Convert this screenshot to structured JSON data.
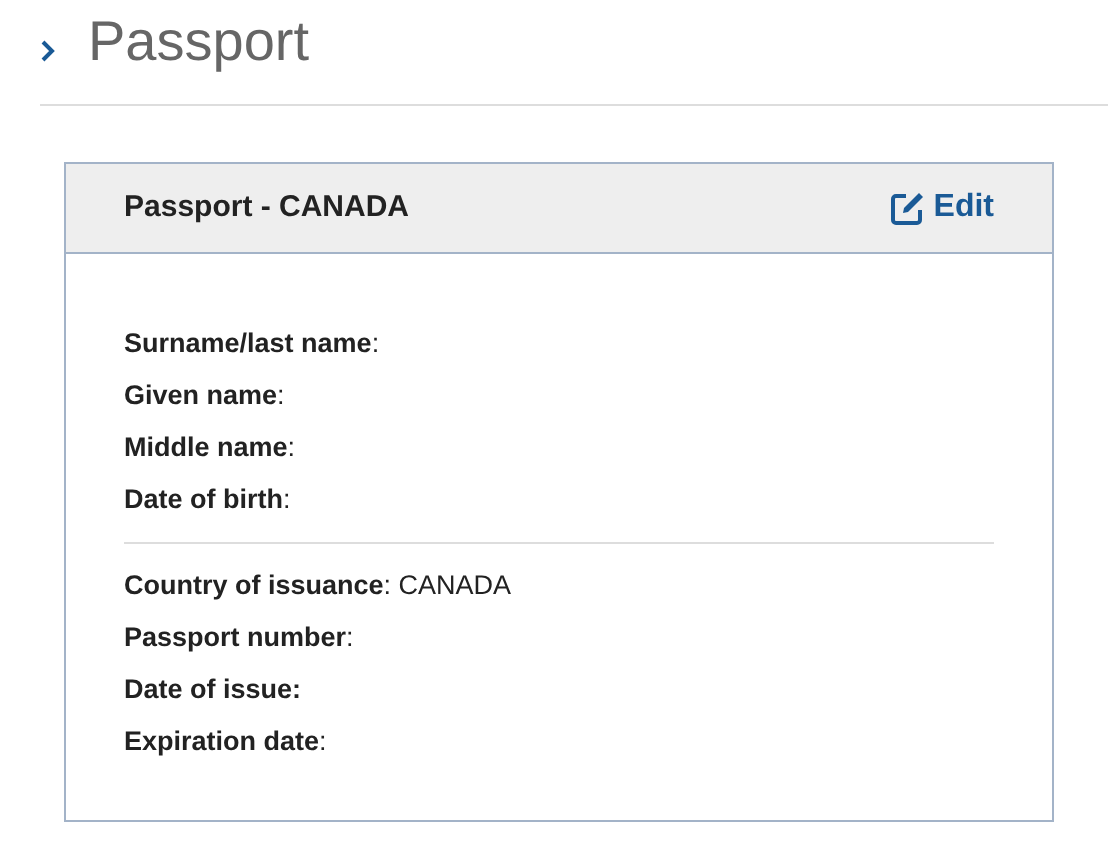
{
  "page_title": "Passport",
  "card": {
    "title": "Passport - CANADA",
    "edit_link": "Edit",
    "groups": [
      {
        "lines": [
          "**Surname/last name**:",
          "**Given name**:",
          "**Middle name**:",
          "**Date of birth**:"
        ]
      },
      {
        "lines": [
          "**Country of issuance**: CANADA",
          "**Passport number**:",
          "**Date of issue:**",
          "**Expiration date**:"
        ]
      }
    ]
  }
}
